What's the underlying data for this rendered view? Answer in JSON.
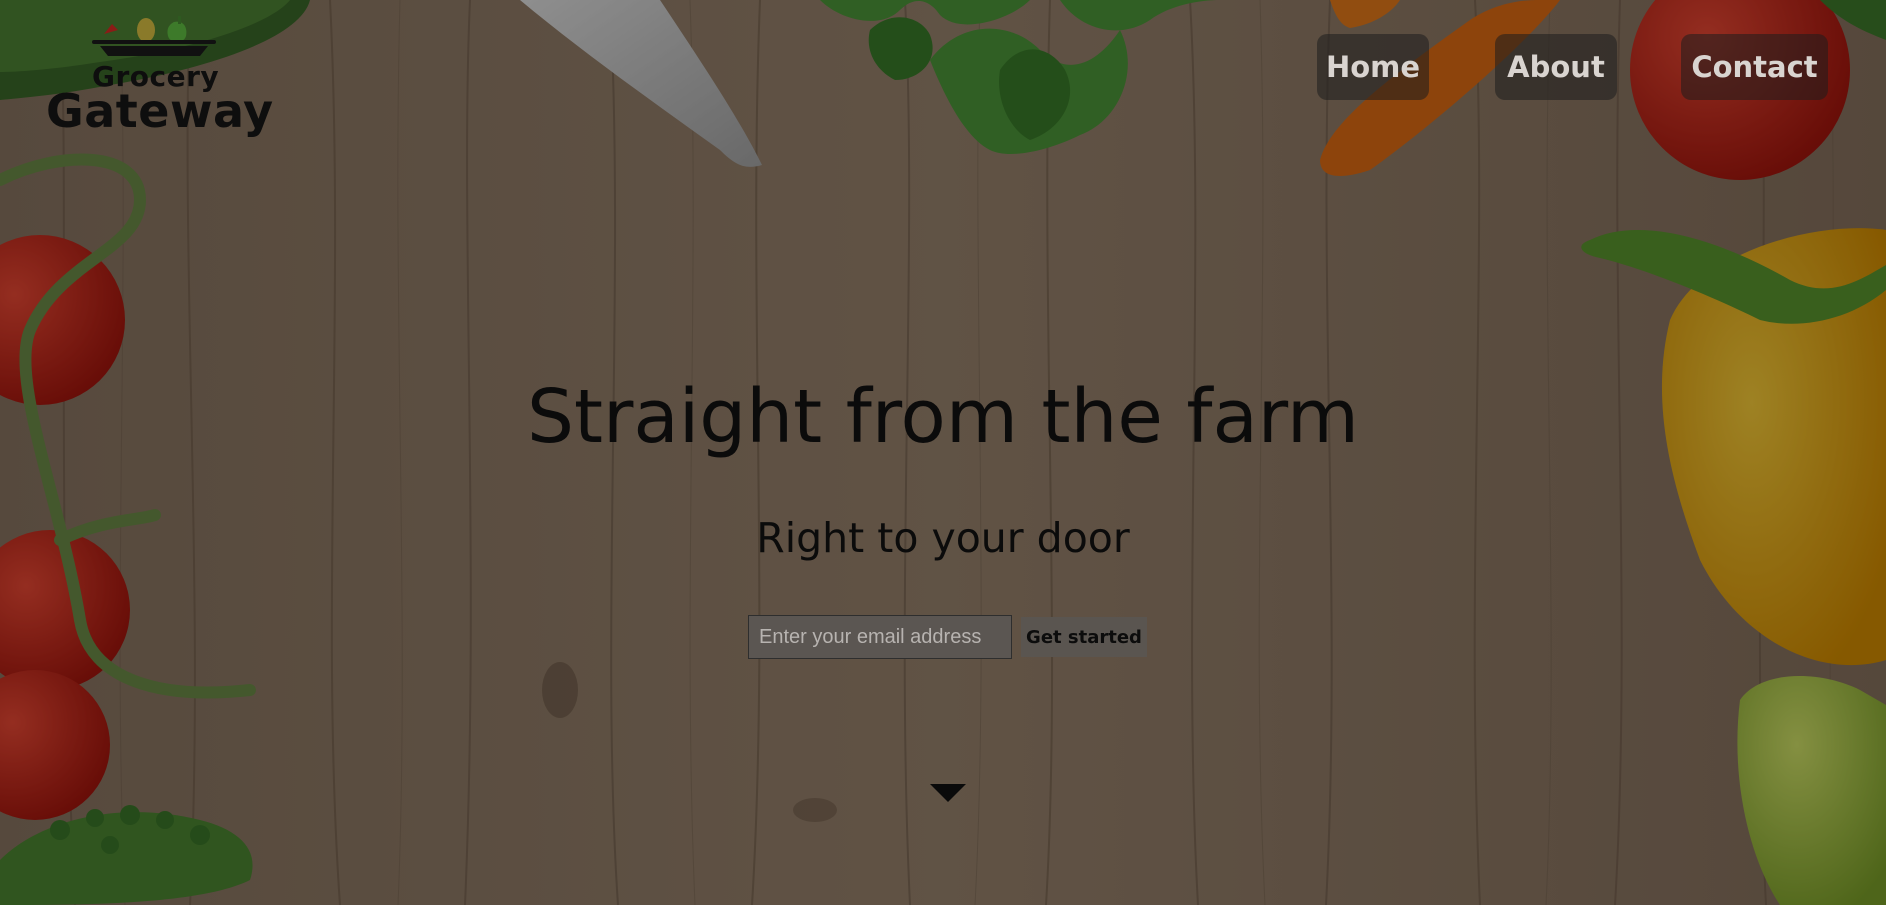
{
  "brand": {
    "name_line1": "Grocery",
    "name_line2": "Gateway"
  },
  "nav": {
    "items": [
      {
        "label": "Home"
      },
      {
        "label": "About"
      },
      {
        "label": "Contact"
      }
    ]
  },
  "hero": {
    "title": "Straight from the farm",
    "subtitle": "Right to your door",
    "email_placeholder": "Enter your email address",
    "cta_label": "Get started"
  },
  "icons": {
    "scroll": "chevron-down-icon",
    "logo_produce": "fruit-basket-icon"
  },
  "colors": {
    "wood": "#6b5848",
    "overlay": "rgba(0,0,0,0.38)",
    "tomato": "#c8291d",
    "pepper_yellow": "#e8b10f",
    "carrot": "#e46f14",
    "herb_green": "#3f7d2c",
    "text_dark": "#0b0b0b",
    "nav_text": "#d9d4d0"
  }
}
